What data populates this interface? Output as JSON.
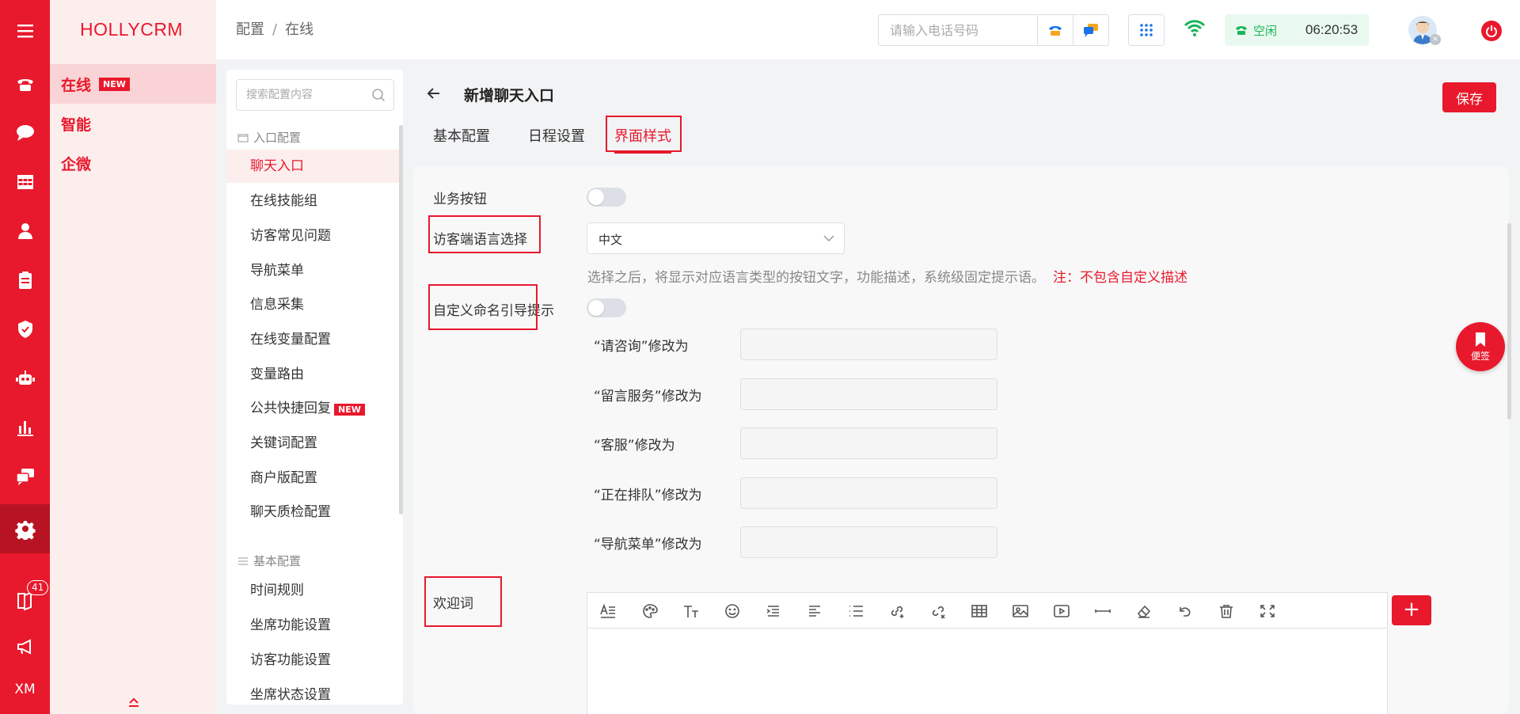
{
  "app": {
    "brand": "HOLLYCRM"
  },
  "rail": {
    "badge_count": "41",
    "user_initials": "XM"
  },
  "modules": [
    {
      "label": "在线",
      "tag": "NEW"
    },
    {
      "label": "智能"
    },
    {
      "label": "企微"
    }
  ],
  "header": {
    "breadcrumb": [
      "配置",
      "在线"
    ],
    "phone_placeholder": "请输入电话号码",
    "status_label": "空闲",
    "status_time": "06:20:53"
  },
  "config": {
    "search_placeholder": "搜索配置内容",
    "group1": "入口配置",
    "items1": [
      "聊天入口",
      "在线技能组",
      "访客常见问题",
      "导航菜单",
      "信息采集",
      "在线变量配置",
      "变量路由",
      "公共快捷回复",
      "关键词配置",
      "商户版配置",
      "聊天质检配置"
    ],
    "new_tag": "NEW",
    "group2": "基本配置",
    "items2": [
      "时间规则",
      "坐席功能设置",
      "访客功能设置",
      "坐席状态设置"
    ]
  },
  "page": {
    "title": "新增聊天入口",
    "tabs": [
      "基本配置",
      "日程设置",
      "界面样式"
    ],
    "save_label": "保存"
  },
  "form": {
    "business_button_label": "业务按钮",
    "language_label": "访客端语言选择",
    "language_value": "中文",
    "language_desc": "选择之后，将显示对应语言类型的按钮文字，功能描述，系统级固定提示语。",
    "language_warn": "注：不包含自定义描述",
    "custom_label": "自定义命名引导提示",
    "renames": [
      "“请咨询”修改为",
      "“留言服务”修改为",
      "“客服”修改为",
      "“正在排队”修改为",
      "“导航菜单”修改为"
    ],
    "welcome_label": "欢迎词"
  },
  "float_note": {
    "label": "便签"
  },
  "colors": {
    "brand_red": "#e8192c",
    "status_green": "#19b55a"
  }
}
